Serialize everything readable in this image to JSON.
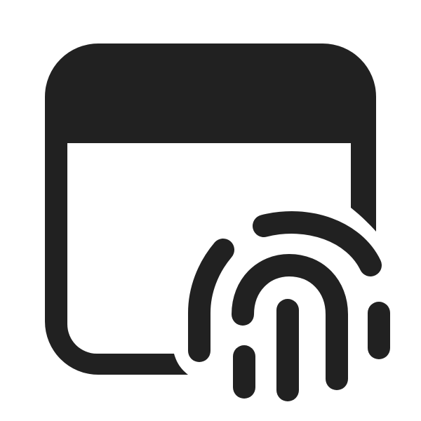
{
  "icon": {
    "name": "window-fingerprint-icon",
    "color": "#212121",
    "background": "#ffffff"
  }
}
